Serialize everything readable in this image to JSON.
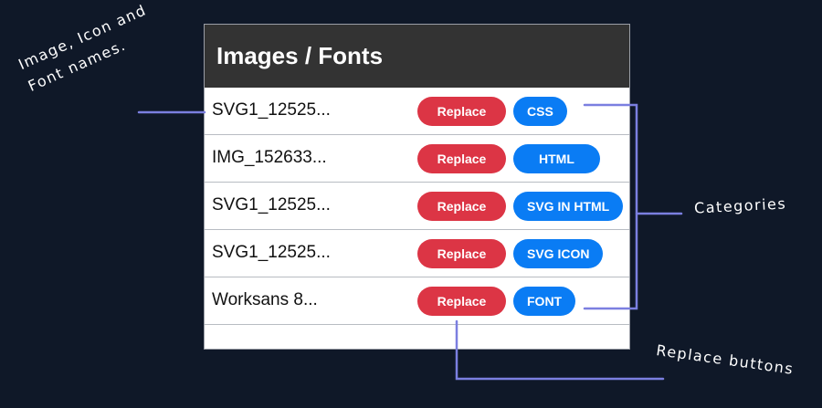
{
  "panel": {
    "title": "Images / Fonts",
    "rows": [
      {
        "name": "SVG1_12525...",
        "replace_label": "Replace",
        "category": "CSS"
      },
      {
        "name": "IMG_152633...",
        "replace_label": "Replace",
        "category": "HTML"
      },
      {
        "name": "SVG1_12525...",
        "replace_label": "Replace",
        "category": "SVG IN HTML"
      },
      {
        "name": "SVG1_12525...",
        "replace_label": "Replace",
        "category": "SVG ICON"
      },
      {
        "name": "Worksans 8...",
        "replace_label": "Replace",
        "category": "FONT"
      }
    ]
  },
  "annotations": {
    "names_line1": "Image, Icon and",
    "names_line2": "Font names.",
    "categories": "Categories",
    "replace": "Replace buttons"
  },
  "colors": {
    "background": "#0f1828",
    "header": "#333333",
    "replace": "#dc3545",
    "category": "#0a7cf4",
    "annotation_line": "#7b7fe0"
  }
}
